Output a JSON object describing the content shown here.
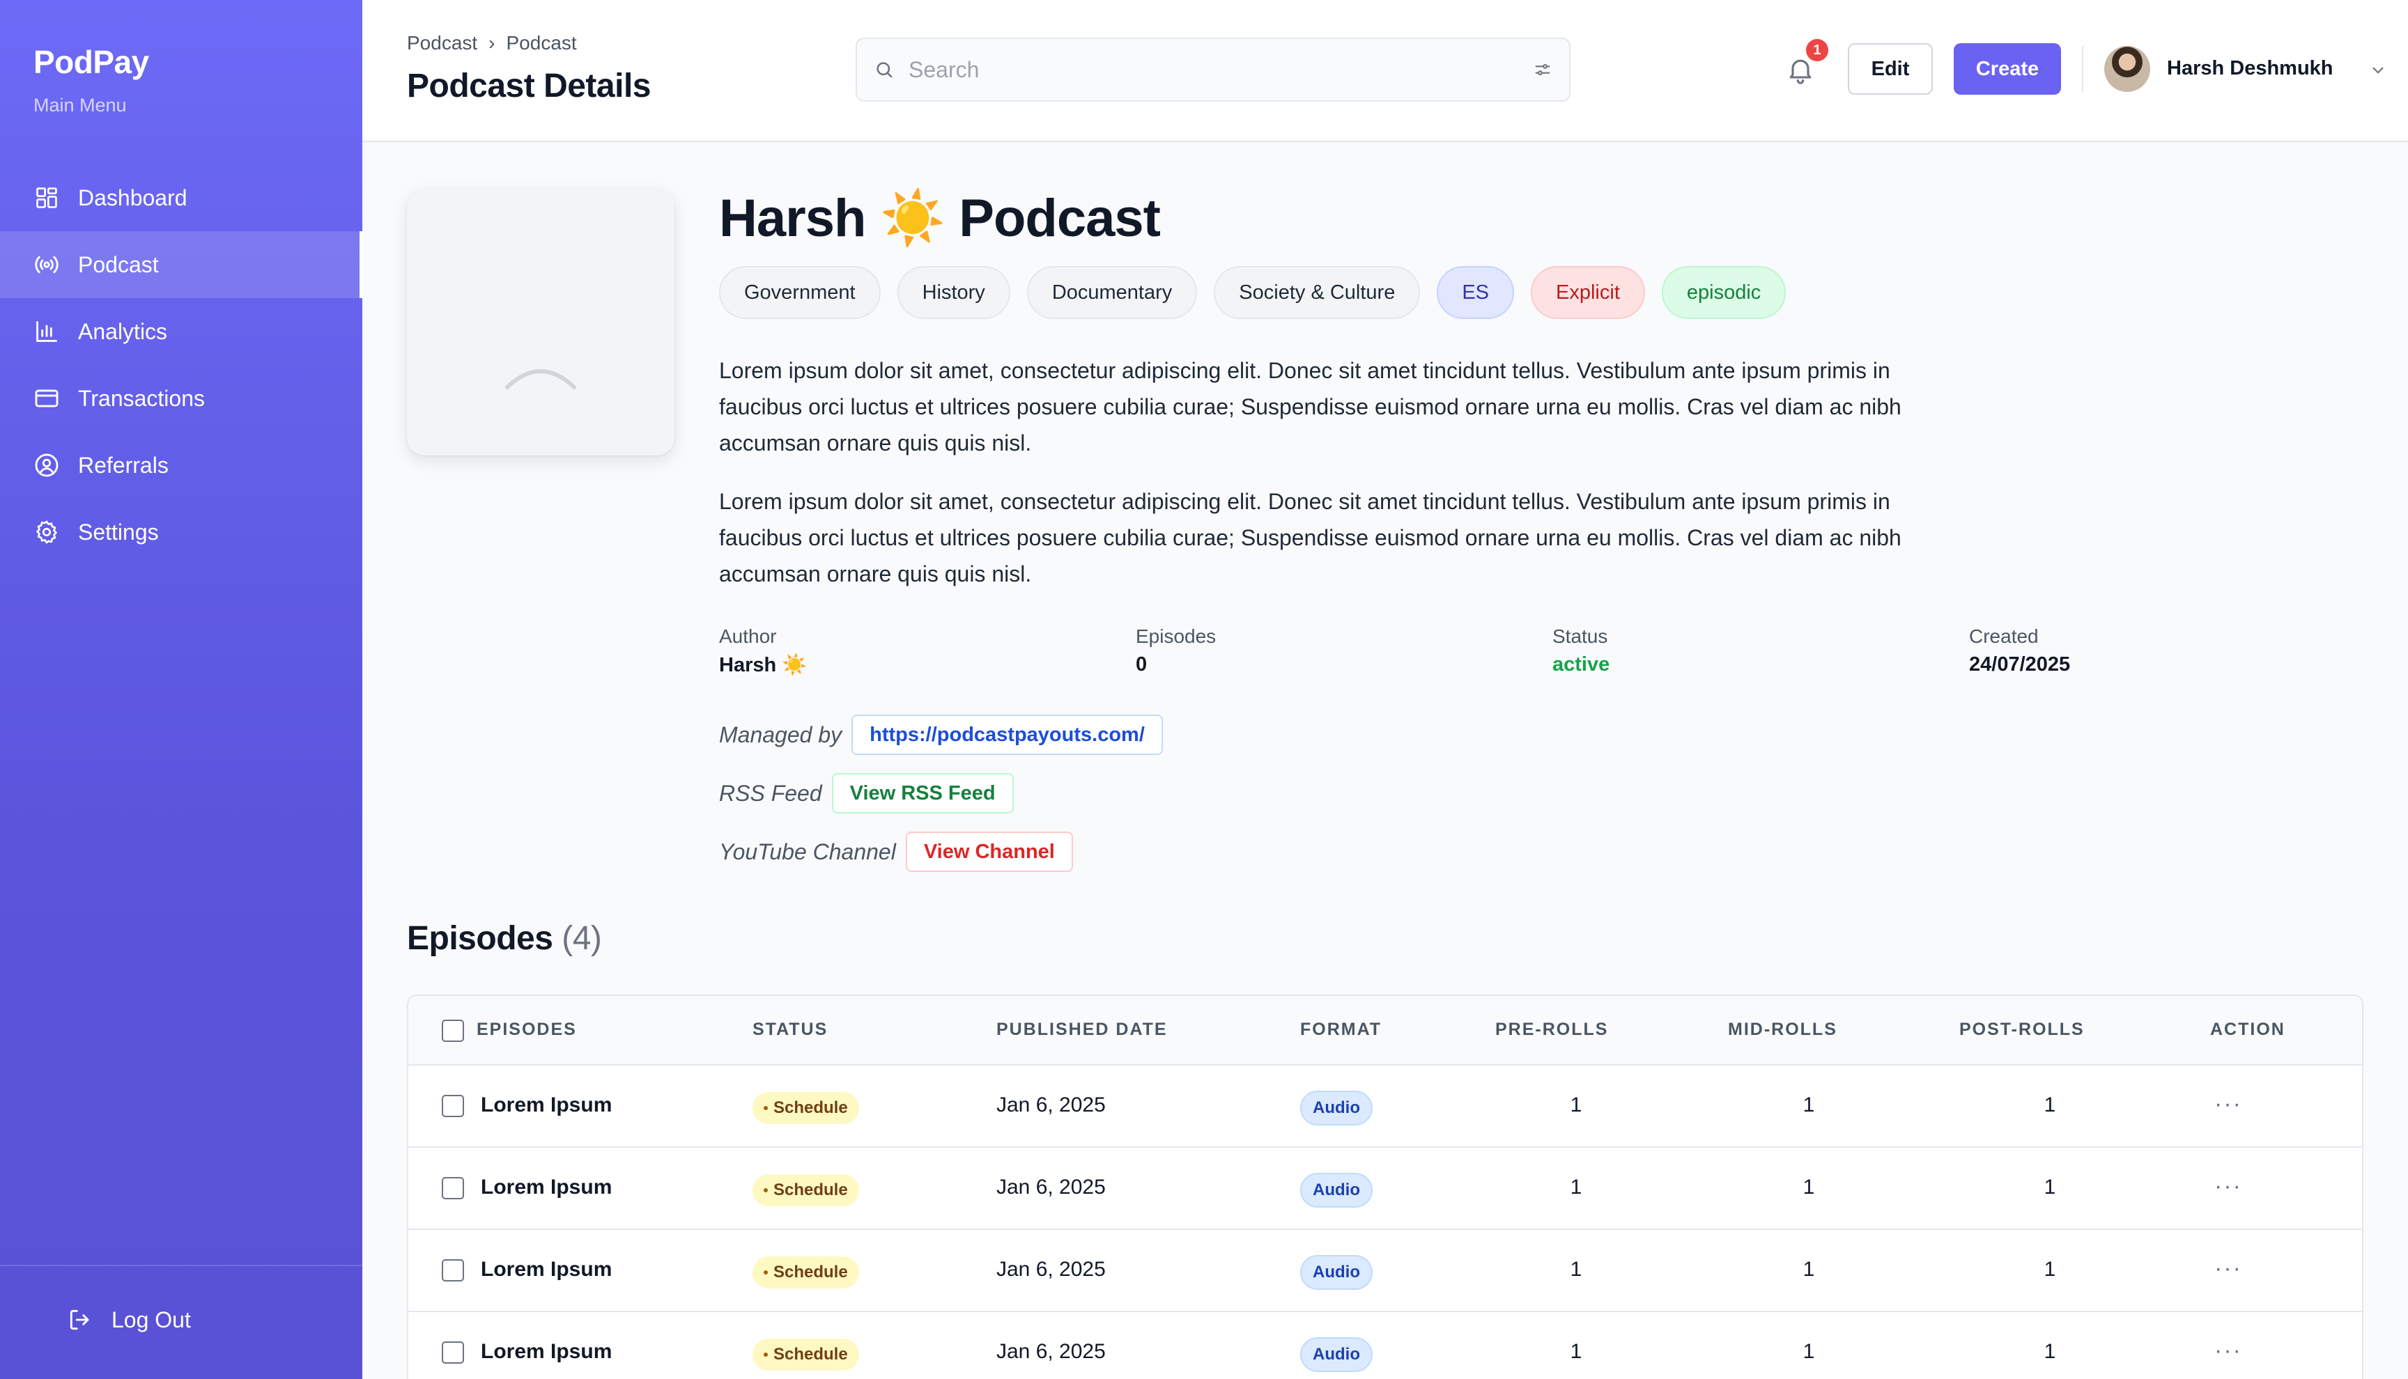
{
  "sidebar": {
    "brand": "PodPay",
    "subtitle": "Main Menu",
    "items": [
      {
        "label": "Dashboard",
        "icon": "grid-icon"
      },
      {
        "label": "Podcast",
        "icon": "broadcast-icon",
        "active": true
      },
      {
        "label": "Analytics",
        "icon": "bar-chart-icon"
      },
      {
        "label": "Transactions",
        "icon": "credit-card-icon"
      },
      {
        "label": "Referrals",
        "icon": "user-circle-icon"
      },
      {
        "label": "Settings",
        "icon": "gear-icon"
      }
    ],
    "logout": "Log Out"
  },
  "header": {
    "breadcrumb": [
      "Podcast",
      "Podcast"
    ],
    "title": "Podcast Details",
    "search_placeholder": "Search",
    "notification_count": "1",
    "edit_label": "Edit",
    "create_label": "Create",
    "user_name": "Harsh Deshmukh"
  },
  "podcast": {
    "title": "Harsh ☀️ Podcast",
    "tags": [
      {
        "label": "Government",
        "variant": "gray"
      },
      {
        "label": "History",
        "variant": "gray"
      },
      {
        "label": "Documentary",
        "variant": "gray"
      },
      {
        "label": "Society & Culture",
        "variant": "gray"
      },
      {
        "label": "ES",
        "variant": "blue"
      },
      {
        "label": "Explicit",
        "variant": "red"
      },
      {
        "label": "episodic",
        "variant": "green"
      }
    ],
    "description": [
      "Lorem ipsum dolor sit amet, consectetur adipiscing elit. Donec sit amet tincidunt tellus. Vestibulum ante ipsum primis in faucibus orci luctus et ultrices posuere cubilia curae; Suspendisse euismod ornare urna eu mollis. Cras vel diam ac nibh accumsan ornare quis quis nisl.",
      "Lorem ipsum dolor sit amet, consectetur adipiscing elit. Donec sit amet tincidunt tellus. Vestibulum ante ipsum primis in faucibus orci luctus et ultrices posuere cubilia curae; Suspendisse euismod ornare urna eu mollis. Cras vel diam ac nibh accumsan ornare quis quis nisl."
    ],
    "meta": {
      "author_label": "Author",
      "author": "Harsh ☀️",
      "episodes_label": "Episodes",
      "episodes": "0",
      "status_label": "Status",
      "status": "active",
      "created_label": "Created",
      "created": "24/07/2025"
    },
    "links": {
      "managed_label": "Managed by",
      "managed_url": "https://podcastpayouts.com/",
      "rss_label": "RSS Feed",
      "rss_button": "View RSS Feed",
      "youtube_label": "YouTube Channel",
      "youtube_button": "View Channel"
    }
  },
  "episodes": {
    "heading": "Episodes",
    "count": "(4)",
    "columns": [
      "EPISODES",
      "STATUS",
      "PUBLISHED DATE",
      "FORMAT",
      "PRE-ROLLS",
      "MID-ROLLS",
      "POST-ROLLS",
      "ACTION"
    ],
    "rows": [
      {
        "name": "Lorem Ipsum",
        "status": "Schedule",
        "date": "Jan 6, 2025",
        "format": "Audio",
        "pre": "1",
        "mid": "1",
        "post": "1"
      },
      {
        "name": "Lorem Ipsum",
        "status": "Schedule",
        "date": "Jan 6, 2025",
        "format": "Audio",
        "pre": "1",
        "mid": "1",
        "post": "1"
      },
      {
        "name": "Lorem Ipsum",
        "status": "Schedule",
        "date": "Jan 6, 2025",
        "format": "Audio",
        "pre": "1",
        "mid": "1",
        "post": "1"
      },
      {
        "name": "Lorem Ipsum",
        "status": "Schedule",
        "date": "Jan 6, 2025",
        "format": "Audio",
        "pre": "1",
        "mid": "1",
        "post": "1"
      }
    ],
    "action_glyph": "···"
  },
  "colors": {
    "accent": "#6a63f1",
    "sidebar_top": "#6d6af7",
    "sidebar_bottom": "#5a52d5",
    "status_active": "#16a34a",
    "badge": "#ef4444"
  }
}
